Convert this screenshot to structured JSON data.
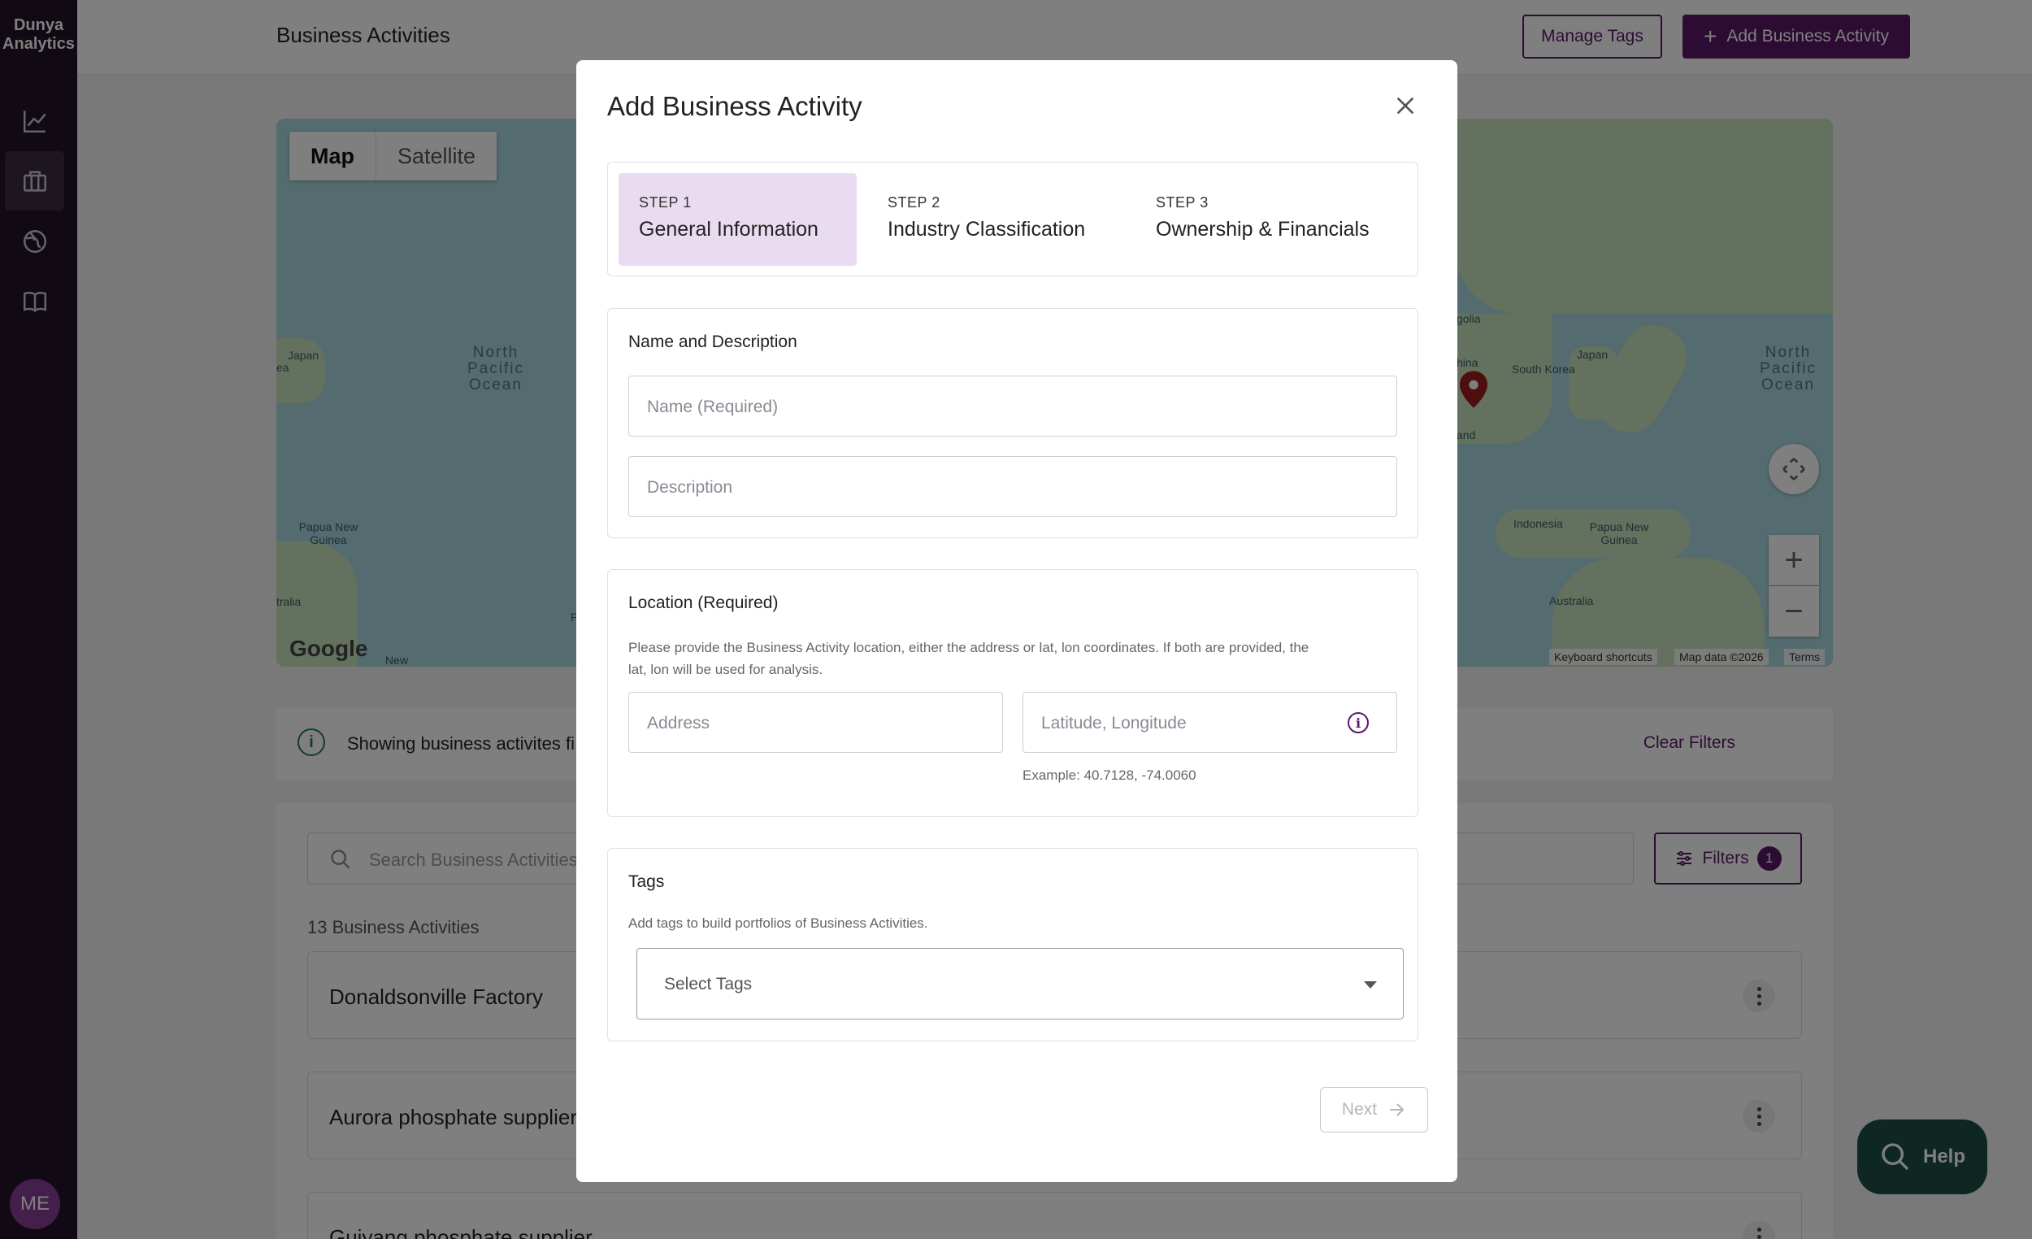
{
  "app": {
    "logo_line1": "Dunya",
    "logo_line2": "Analytics",
    "avatar_initials": "ME",
    "brand_color": "#5a1868"
  },
  "sidebar": {
    "items": [
      {
        "icon": "chart-icon"
      },
      {
        "icon": "briefcase-icon",
        "active": true
      },
      {
        "icon": "globe-icon"
      },
      {
        "icon": "book-icon"
      }
    ]
  },
  "header": {
    "title": "Business Activities",
    "manage_tags_label": "Manage Tags",
    "add_activity_label": "Add Business Activity"
  },
  "map": {
    "toggle_map": "Map",
    "toggle_satellite": "Satellite",
    "labels": {
      "japan_left": "Japan",
      "north_pacific_left": "North Pacific Ocean",
      "png_left": "Papua New Guinea",
      "australia_left": "tralia",
      "ea_left": "ea",
      "new_label": "New",
      "mongolia": "golia",
      "china": "hina",
      "south_korea": "South Korea",
      "japan_right": "Japan",
      "north_pacific_right": "North Pacific Ocean",
      "thailand": "and",
      "indonesia": "Indonesia",
      "png_right": "Papua New Guinea",
      "australia_right": "Australia",
      "partial_f": "F"
    },
    "google": "Google",
    "keyboard_shortcuts": "Keyboard shortcuts",
    "map_data": "Map data ©2026",
    "terms": "Terms"
  },
  "info_bar": {
    "text": "Showing business activites fi",
    "clear_filters": "Clear Filters"
  },
  "list": {
    "search_placeholder": "Search Business Activities",
    "filters_label": "Filters",
    "filters_count": "1",
    "count_label": "13 Business Activities",
    "items": [
      {
        "name": "Donaldsonville Factory"
      },
      {
        "name": "Aurora phosphate supplier"
      },
      {
        "name": "Guiyang phosphate supplier"
      }
    ]
  },
  "help_label": "Help",
  "modal": {
    "title": "Add Business Activity",
    "steps": [
      {
        "num": "STEP 1",
        "label": "General Information",
        "active": true
      },
      {
        "num": "STEP 2",
        "label": "Industry Classification"
      },
      {
        "num": "STEP 3",
        "label": "Ownership & Financials"
      }
    ],
    "name_section": {
      "title": "Name and Description",
      "name_placeholder": "Name (Required)",
      "description_placeholder": "Description"
    },
    "location_section": {
      "title": "Location (Required)",
      "desc_line1": "Please provide the Business Activity location, either the address or lat, lon coordinates. If both are provided, the",
      "desc_line2": "lat, lon will be used for analysis.",
      "address_placeholder": "Address",
      "latlon_placeholder": "Latitude, Longitude",
      "example": "Example: 40.7128, -74.0060"
    },
    "tags_section": {
      "title": "Tags",
      "desc": "Add tags to build portfolios of Business Activities.",
      "select_placeholder": "Select Tags"
    },
    "next_label": "Next"
  }
}
